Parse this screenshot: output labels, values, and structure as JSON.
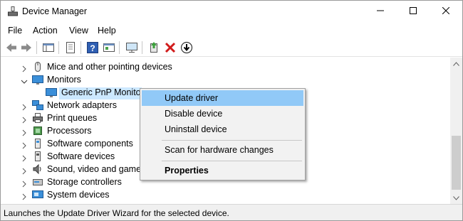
{
  "window": {
    "title": "Device Manager",
    "icon": "device-manager-icon"
  },
  "title_buttons": {
    "minimize": "minimize-icon",
    "maximize": "maximize-icon",
    "close": "close-icon"
  },
  "menu": {
    "items": [
      "File",
      "Action",
      "View",
      "Help"
    ]
  },
  "toolbar": {
    "buttons": [
      "back-icon",
      "forward-icon",
      "show-hide-tree-icon",
      "properties-icon",
      "help-icon",
      "view-icon",
      "scan-hardware-icon",
      "update-driver-icon",
      "uninstall-icon",
      "disable-device-icon"
    ]
  },
  "tree": {
    "rows": [
      {
        "label": "Mice and other pointing devices",
        "expanded": false,
        "icon": "mouse-icon"
      },
      {
        "label": "Monitors",
        "expanded": true,
        "icon": "monitor-icon"
      },
      {
        "label": "Generic PnP Monitor",
        "child": true,
        "selected": true,
        "icon": "monitor-icon"
      },
      {
        "label": "Network adapters",
        "expanded": false,
        "icon": "network-adapter-icon"
      },
      {
        "label": "Print queues",
        "expanded": false,
        "icon": "printer-icon"
      },
      {
        "label": "Processors",
        "expanded": false,
        "icon": "processor-icon"
      },
      {
        "label": "Software components",
        "expanded": false,
        "icon": "software-component-icon"
      },
      {
        "label": "Software devices",
        "expanded": false,
        "icon": "software-device-icon"
      },
      {
        "label": "Sound, video and game c",
        "expanded": false,
        "icon": "speaker-icon"
      },
      {
        "label": "Storage controllers",
        "expanded": false,
        "icon": "storage-controller-icon"
      },
      {
        "label": "System devices",
        "expanded": false,
        "icon": "system-device-icon"
      }
    ]
  },
  "context_menu": {
    "items": [
      {
        "label": "Update driver",
        "highlighted": true
      },
      {
        "label": "Disable device"
      },
      {
        "label": "Uninstall device"
      },
      {
        "label": "Scan for hardware changes"
      },
      {
        "label": "Properties",
        "bold": true
      }
    ]
  },
  "status": {
    "text": "Launches the Update Driver Wizard for the selected device."
  },
  "colors": {
    "selection": "#cce8ff",
    "menu_highlight": "#91c9f7",
    "accent": "#1e72c8"
  }
}
